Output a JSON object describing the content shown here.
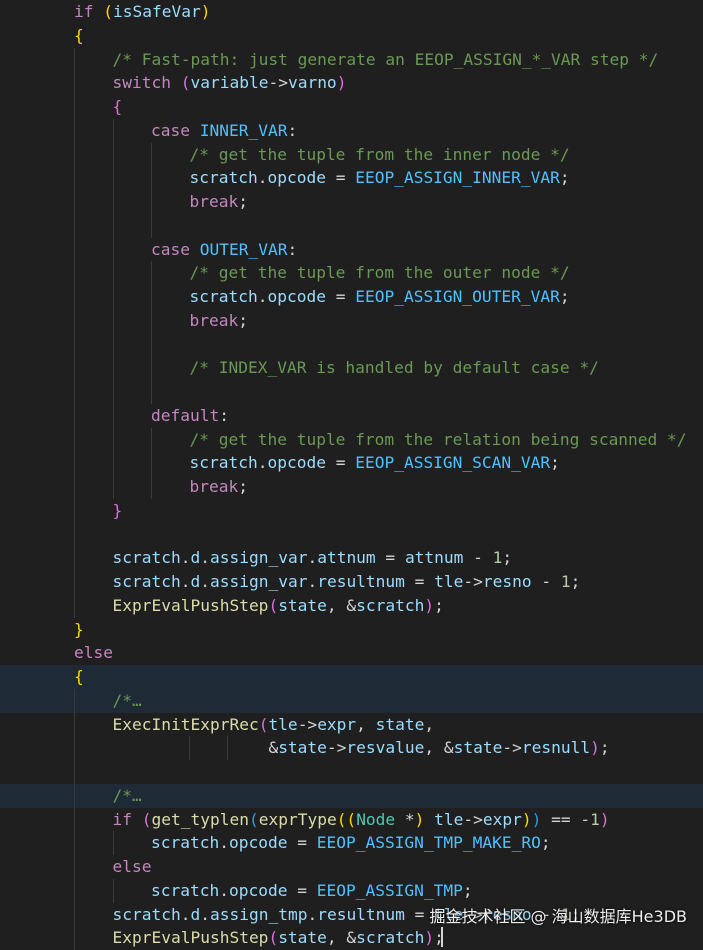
{
  "code_lines": [
    {
      "indent": 0,
      "tokens": [
        [
          "kw",
          "if"
        ],
        [
          "op",
          " "
        ],
        [
          "b1",
          "("
        ],
        [
          "vr",
          "isSafeVar"
        ],
        [
          "b1",
          ")"
        ]
      ]
    },
    {
      "indent": 0,
      "tokens": [
        [
          "b1",
          "{"
        ]
      ]
    },
    {
      "indent": 1,
      "tokens": [
        [
          "cm",
          "/* Fast-path: just generate an EEOP_ASSIGN_*_VAR step */"
        ]
      ]
    },
    {
      "indent": 1,
      "tokens": [
        [
          "kw",
          "switch"
        ],
        [
          "op",
          " "
        ],
        [
          "b2",
          "("
        ],
        [
          "vr",
          "variable"
        ],
        [
          "op",
          "->"
        ],
        [
          "vr",
          "varno"
        ],
        [
          "b2",
          ")"
        ]
      ]
    },
    {
      "indent": 1,
      "tokens": [
        [
          "b2",
          "{"
        ]
      ]
    },
    {
      "indent": 2,
      "tokens": [
        [
          "kw",
          "case"
        ],
        [
          "op",
          " "
        ],
        [
          "en",
          "INNER_VAR"
        ],
        [
          "op",
          ":"
        ]
      ]
    },
    {
      "indent": 3,
      "tokens": [
        [
          "cm",
          "/* get the tuple from the inner node */"
        ]
      ]
    },
    {
      "indent": 3,
      "tokens": [
        [
          "vr",
          "scratch"
        ],
        [
          "op",
          "."
        ],
        [
          "vr",
          "opcode"
        ],
        [
          "op",
          " = "
        ],
        [
          "en",
          "EEOP_ASSIGN_INNER_VAR"
        ],
        [
          "op",
          ";"
        ]
      ]
    },
    {
      "indent": 3,
      "tokens": [
        [
          "kw",
          "break"
        ],
        [
          "op",
          ";"
        ]
      ]
    },
    {
      "indent": 3,
      "tokens": []
    },
    {
      "indent": 2,
      "tokens": [
        [
          "kw",
          "case"
        ],
        [
          "op",
          " "
        ],
        [
          "en",
          "OUTER_VAR"
        ],
        [
          "op",
          ":"
        ]
      ]
    },
    {
      "indent": 3,
      "tokens": [
        [
          "cm",
          "/* get the tuple from the outer node */"
        ]
      ]
    },
    {
      "indent": 3,
      "tokens": [
        [
          "vr",
          "scratch"
        ],
        [
          "op",
          "."
        ],
        [
          "vr",
          "opcode"
        ],
        [
          "op",
          " = "
        ],
        [
          "en",
          "EEOP_ASSIGN_OUTER_VAR"
        ],
        [
          "op",
          ";"
        ]
      ]
    },
    {
      "indent": 3,
      "tokens": [
        [
          "kw",
          "break"
        ],
        [
          "op",
          ";"
        ]
      ]
    },
    {
      "indent": 3,
      "tokens": []
    },
    {
      "indent": 3,
      "tokens": [
        [
          "cm",
          "/* INDEX_VAR is handled by default case */"
        ]
      ]
    },
    {
      "indent": 3,
      "tokens": []
    },
    {
      "indent": 2,
      "tokens": [
        [
          "kw",
          "default"
        ],
        [
          "op",
          ":"
        ]
      ]
    },
    {
      "indent": 3,
      "tokens": [
        [
          "cm",
          "/* get the tuple from the relation being scanned */"
        ]
      ]
    },
    {
      "indent": 3,
      "tokens": [
        [
          "vr",
          "scratch"
        ],
        [
          "op",
          "."
        ],
        [
          "vr",
          "opcode"
        ],
        [
          "op",
          " = "
        ],
        [
          "en",
          "EEOP_ASSIGN_SCAN_VAR"
        ],
        [
          "op",
          ";"
        ]
      ]
    },
    {
      "indent": 3,
      "tokens": [
        [
          "kw",
          "break"
        ],
        [
          "op",
          ";"
        ]
      ]
    },
    {
      "indent": 1,
      "tokens": [
        [
          "b2",
          "}"
        ]
      ]
    },
    {
      "indent": 1,
      "tokens": []
    },
    {
      "indent": 1,
      "tokens": [
        [
          "vr",
          "scratch"
        ],
        [
          "op",
          "."
        ],
        [
          "vr",
          "d"
        ],
        [
          "op",
          "."
        ],
        [
          "vr",
          "assign_var"
        ],
        [
          "op",
          "."
        ],
        [
          "vr",
          "attnum"
        ],
        [
          "op",
          " = "
        ],
        [
          "vr",
          "attnum"
        ],
        [
          "op",
          " - "
        ],
        [
          "nu",
          "1"
        ],
        [
          "op",
          ";"
        ]
      ]
    },
    {
      "indent": 1,
      "tokens": [
        [
          "vr",
          "scratch"
        ],
        [
          "op",
          "."
        ],
        [
          "vr",
          "d"
        ],
        [
          "op",
          "."
        ],
        [
          "vr",
          "assign_var"
        ],
        [
          "op",
          "."
        ],
        [
          "vr",
          "resultnum"
        ],
        [
          "op",
          " = "
        ],
        [
          "vr",
          "tle"
        ],
        [
          "op",
          "->"
        ],
        [
          "vr",
          "resno"
        ],
        [
          "op",
          " - "
        ],
        [
          "nu",
          "1"
        ],
        [
          "op",
          ";"
        ]
      ]
    },
    {
      "indent": 1,
      "tokens": [
        [
          "fn",
          "ExprEvalPushStep"
        ],
        [
          "b2",
          "("
        ],
        [
          "vr",
          "state"
        ],
        [
          "op",
          ", &"
        ],
        [
          "vr",
          "scratch"
        ],
        [
          "b2",
          ")"
        ],
        [
          "op",
          ";"
        ]
      ]
    },
    {
      "indent": 0,
      "tokens": [
        [
          "b1",
          "}"
        ]
      ]
    },
    {
      "indent": 0,
      "tokens": [
        [
          "kw",
          "else"
        ]
      ]
    },
    {
      "indent": 0,
      "hl": true,
      "tokens": [
        [
          "b1",
          "{"
        ]
      ]
    },
    {
      "indent": 1,
      "hl": true,
      "tokens": [
        [
          "cm",
          "/*"
        ],
        [
          "fold",
          "…"
        ]
      ]
    },
    {
      "indent": 1,
      "tokens": [
        [
          "fn",
          "ExecInitExprRec"
        ],
        [
          "b2",
          "("
        ],
        [
          "vr",
          "tle"
        ],
        [
          "op",
          "->"
        ],
        [
          "vr",
          "expr"
        ],
        [
          "op",
          ", "
        ],
        [
          "vr",
          "state"
        ],
        [
          "op",
          ","
        ]
      ]
    },
    {
      "indent": 1,
      "extra_guides": [
        189,
        227
      ],
      "tokens": [
        [
          "op",
          "                "
        ],
        [
          "op",
          "&"
        ],
        [
          "vr",
          "state"
        ],
        [
          "op",
          "->"
        ],
        [
          "vr",
          "resvalue"
        ],
        [
          "op",
          ", &"
        ],
        [
          "vr",
          "state"
        ],
        [
          "op",
          "->"
        ],
        [
          "vr",
          "resnull"
        ],
        [
          "b2",
          ")"
        ],
        [
          "op",
          ";"
        ]
      ]
    },
    {
      "indent": 1,
      "tokens": []
    },
    {
      "indent": 1,
      "hl": true,
      "tokens": [
        [
          "cm",
          "/*"
        ],
        [
          "fold",
          "…"
        ]
      ]
    },
    {
      "indent": 1,
      "tokens": [
        [
          "kw",
          "if"
        ],
        [
          "op",
          " "
        ],
        [
          "b2",
          "("
        ],
        [
          "fn",
          "get_typlen"
        ],
        [
          "b3",
          "("
        ],
        [
          "fn",
          "exprType"
        ],
        [
          "b1",
          "(("
        ],
        [
          "ty",
          "Node"
        ],
        [
          "op",
          " *"
        ],
        [
          "b1",
          ")"
        ],
        [
          "op",
          " "
        ],
        [
          "vr",
          "tle"
        ],
        [
          "op",
          "->"
        ],
        [
          "vr",
          "expr"
        ],
        [
          "b1",
          ")"
        ],
        [
          "b3",
          ")"
        ],
        [
          "op",
          " == -"
        ],
        [
          "nu",
          "1"
        ],
        [
          "b2",
          ")"
        ]
      ]
    },
    {
      "indent": 2,
      "tokens": [
        [
          "vr",
          "scratch"
        ],
        [
          "op",
          "."
        ],
        [
          "vr",
          "opcode"
        ],
        [
          "op",
          " = "
        ],
        [
          "en",
          "EEOP_ASSIGN_TMP_MAKE_RO"
        ],
        [
          "op",
          ";"
        ]
      ]
    },
    {
      "indent": 1,
      "tokens": [
        [
          "kw",
          "else"
        ]
      ]
    },
    {
      "indent": 2,
      "tokens": [
        [
          "vr",
          "scratch"
        ],
        [
          "op",
          "."
        ],
        [
          "vr",
          "opcode"
        ],
        [
          "op",
          " = "
        ],
        [
          "en",
          "EEOP_ASSIGN_TMP"
        ],
        [
          "op",
          ";"
        ]
      ]
    },
    {
      "indent": 1,
      "tokens": [
        [
          "vr",
          "scratch"
        ],
        [
          "op",
          "."
        ],
        [
          "vr",
          "d"
        ],
        [
          "op",
          "."
        ],
        [
          "vr",
          "assign_tmp"
        ],
        [
          "op",
          "."
        ],
        [
          "vr",
          "resultnum"
        ],
        [
          "op",
          " = "
        ],
        [
          "vr",
          "tle"
        ],
        [
          "op",
          "->"
        ],
        [
          "vr",
          "resno"
        ],
        [
          "op",
          " - "
        ],
        [
          "nu",
          "1"
        ],
        [
          "op",
          ";"
        ]
      ]
    },
    {
      "indent": 1,
      "tokens": [
        [
          "fn",
          "ExprEvalPushStep"
        ],
        [
          "b2",
          "("
        ],
        [
          "vr",
          "state"
        ],
        [
          "op",
          ", &"
        ],
        [
          "vr",
          "scratch"
        ],
        [
          "b2",
          ")"
        ],
        [
          "op",
          ";"
        ]
      ]
    }
  ],
  "watermark": "掘金技术社区 @ 海山数据库He3DB"
}
